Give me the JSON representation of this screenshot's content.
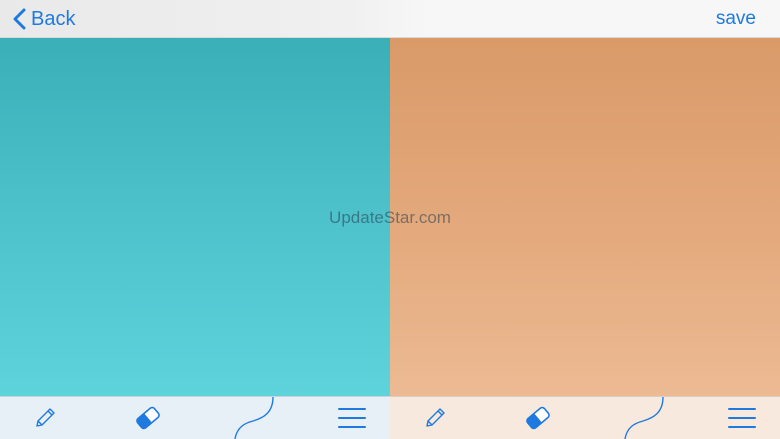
{
  "navbar": {
    "back_label": "Back",
    "save_label": "save"
  },
  "watermark": "UpdateStar.com",
  "toolbars": {
    "left": [
      "pencil-icon",
      "eraser-icon",
      "curve-icon",
      "menu-icon"
    ],
    "right": [
      "pencil-icon",
      "eraser-icon",
      "curve-icon",
      "menu-icon"
    ]
  },
  "colors": {
    "accent": "#1f7ae0",
    "canvas_left_top": "#3aafb8",
    "canvas_left_bottom": "#5fd3dc",
    "canvas_right_top": "#d99a68",
    "canvas_right_bottom": "#ecba93"
  }
}
